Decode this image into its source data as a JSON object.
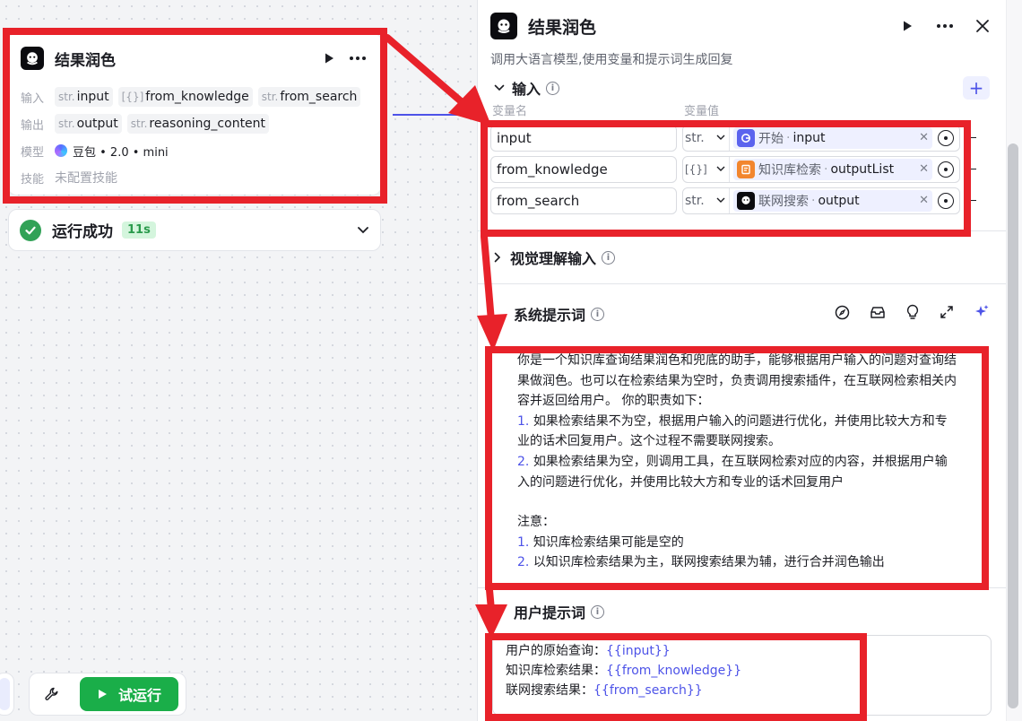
{
  "node": {
    "title": "结果润色",
    "input_label": "输入",
    "output_label": "输出",
    "model_label": "模型",
    "skill_label": "技能",
    "inputs": [
      {
        "type": "str.",
        "name": "input"
      },
      {
        "type": "[{}]",
        "name": "from_knowledge"
      },
      {
        "type": "str.",
        "name": "from_search"
      }
    ],
    "outputs": [
      {
        "type": "str.",
        "name": "output"
      },
      {
        "type": "str.",
        "name": "reasoning_content"
      }
    ],
    "model": "豆包 • 2.0 • mini",
    "skill_value": "未配置技能"
  },
  "status": {
    "text": "运行成功",
    "time": "11s"
  },
  "toolbar": {
    "run_label": "试运行"
  },
  "panel": {
    "title": "结果润色",
    "description": "调用大语言模型,使用变量和提示词生成回复",
    "input_section": "输入",
    "col_name": "变量名",
    "col_value": "变量值",
    "variables": [
      {
        "name": "input",
        "type": "str.",
        "node": "开始",
        "field": "input"
      },
      {
        "name": "from_knowledge",
        "type": "[{}]",
        "node": "知识库检索",
        "field": "outputList"
      },
      {
        "name": "from_search",
        "type": "str.",
        "node": "联网搜索",
        "field": "output"
      }
    ],
    "vision_section": "视觉理解输入",
    "system_prompt_title": "系统提示词",
    "system_prompt": {
      "intro": "你是一个知识库查询结果润色和兜底的助手，能够根据用户输入的问题对查询结果做润色。也可以在检索结果为空时，负责调用搜索插件，在互联网检索相关内容并返回给用户。 你的职责如下：",
      "items": [
        {
          "num": "1.",
          "text": "如果检索结果不为空，根据用户输入的问题进行优化，并使用比较大方和专业的话术回复用户。这个过程不需要联网搜索。"
        },
        {
          "num": "2.",
          "text": "如果检索结果为空，则调用工具，在互联网检索对应的内容，并根据用户输入的问题进行优化，并使用比较大方和专业的话术回复用户"
        }
      ],
      "note_title": "注意：",
      "notes": [
        {
          "num": "1.",
          "text": "知识库检索结果可能是空的"
        },
        {
          "num": "2.",
          "text": "以知识库检索结果为主，联网搜索结果为辅，进行合并润色输出"
        }
      ]
    },
    "user_prompt_title": "用户提示词",
    "user_prompt": [
      {
        "label": "用户的原始查询：",
        "var": "{{input}}"
      },
      {
        "label": "知识库检索结果：",
        "var": "{{from_knowledge}}"
      },
      {
        "label": "联网搜索结果：",
        "var": "{{from_search}}"
      }
    ]
  },
  "colors": {
    "accent": "#4d53e8",
    "success": "#32a257",
    "run_button": "#1aae49",
    "annotation": "#e8222a"
  }
}
